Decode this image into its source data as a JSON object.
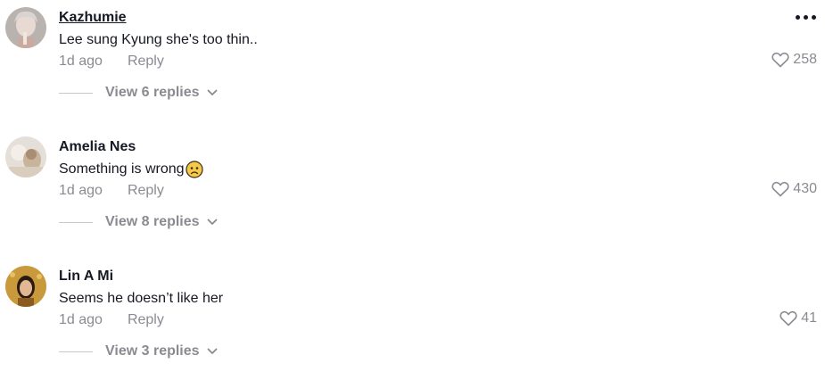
{
  "comments": [
    {
      "username": "Kazhumie",
      "text": "Lee sung Kyung she's too thin..",
      "time": "1d ago",
      "reply_label": "Reply",
      "likes": "258",
      "view_replies": "View 6 replies",
      "avatar_icon": "avatar-photo"
    },
    {
      "username": "Amelia Nes",
      "text": "Something is wrong",
      "emoji": "worried-face-emoji",
      "time": "1d ago",
      "reply_label": "Reply",
      "likes": "430",
      "view_replies": "View 8 replies",
      "avatar_icon": "avatar-photo"
    },
    {
      "username": "Lin A Mi",
      "text": "Seems he doesn’t like her",
      "time": "1d ago",
      "reply_label": "Reply",
      "likes": "41",
      "view_replies": "View 3 replies",
      "avatar_icon": "avatar-photo"
    }
  ],
  "colors": {
    "text_primary": "#161823",
    "text_secondary": "#8a8b91",
    "divider": "#c7c8cc"
  },
  "icons": {
    "like": "heart-outline-icon",
    "more": "more-dots-icon",
    "expand": "chevron-down-icon"
  }
}
